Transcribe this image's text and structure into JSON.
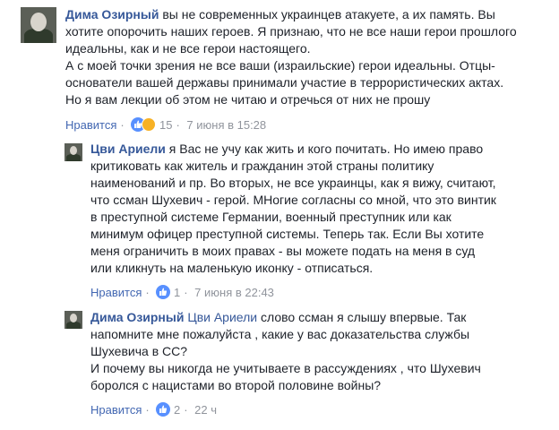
{
  "comments": [
    {
      "author": "Дима Озирный",
      "lines": [
        "вы не современных украинцев атакуете, а их память. Вы",
        "хотите опорочить наших героев. Я признаю, что не все наши герои прошлого",
        "идеальны, как и не все герои настоящего.",
        "А с моей точки зрения не все ваши (израильские) герои идеальны. Отцы-",
        "основатели вашей державы принимали участие в террористических актах.",
        "Но я вам лекции об этом не читаю и отречься от них не прошу"
      ],
      "like_label": "Нравится",
      "reaction_count": "15",
      "time": "7 июня в 15:28"
    },
    {
      "author": "Цви Ариели",
      "lines": [
        "я Вас не учу как жить и кого почитать. Но имею право",
        "критиковать как житель и гражданин этой страны политику",
        "наименований и пр. Во вторых, не все украинцы, как я вижу, считают,",
        "что ссман Шухевич - герой. МНогие согласны со мной, что это винтик",
        "в преступной системе Германии, военный преступник или как",
        "минимум офицер преступной системы. Теперь так. Если Вы хотите",
        "меня ограничить в моих правах - вы можете подать на меня в суд",
        "или кликнуть на маленькую иконку - отписаться."
      ],
      "like_label": "Нравится",
      "reaction_count": "1",
      "time": "7 июня в 22:43"
    },
    {
      "author": "Дима Озирный",
      "mention": "Цви Ариели",
      "lines": [
        "слово ссман я слышу впервые. Так",
        "напомните мне пожалуйста , какие у вас доказательства службы",
        "Шухевича в СС?",
        "И почему вы никогда не учитываете в рассуждениях , что Шухевич",
        "боролся с нацистами во второй половине войны?"
      ],
      "like_label": "Нравится",
      "reaction_count": "2",
      "time": "22 ч"
    }
  ],
  "colors": {
    "link": "#365899",
    "meta": "#90949c",
    "like_action": "#4267b2",
    "like_reaction": "#5890ff",
    "wow_reaction": "#f7b125"
  }
}
